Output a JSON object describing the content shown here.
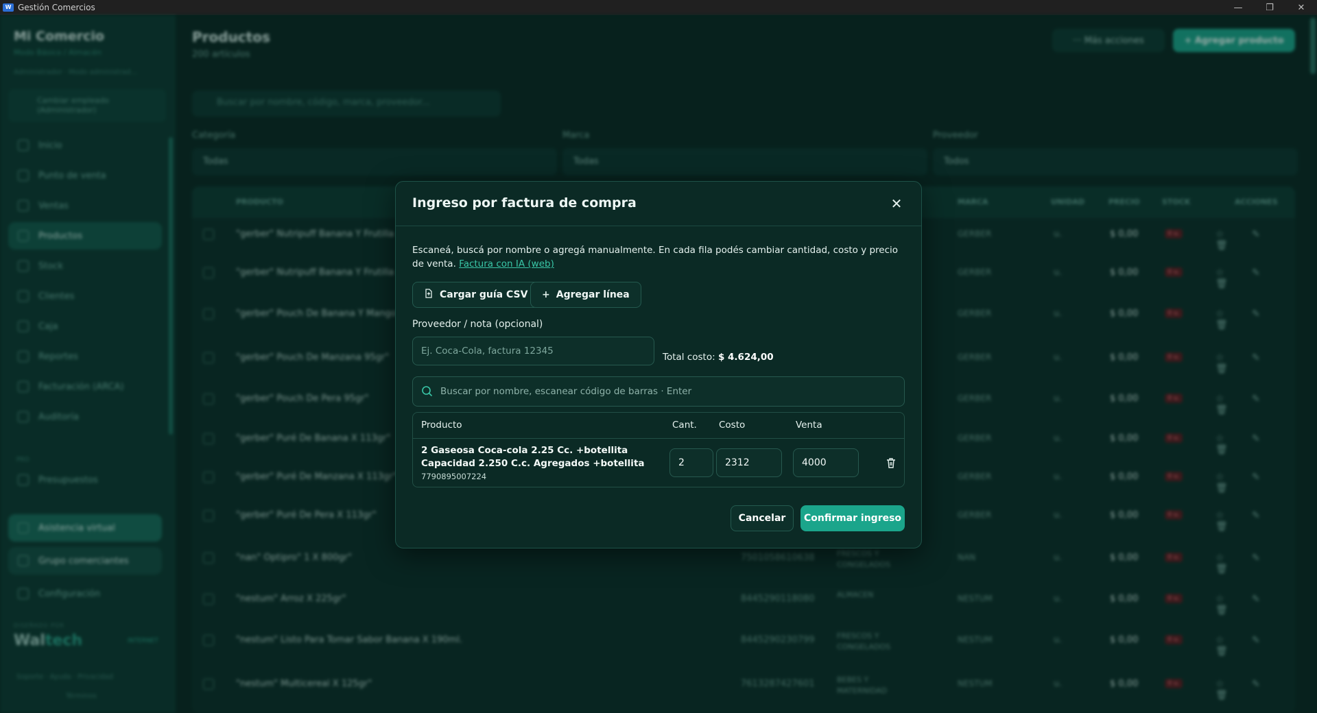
{
  "window": {
    "title": "Gestión Comercios",
    "logo_text": "W"
  },
  "sidebar": {
    "title": "Mi Comercio",
    "subtitle": "Modo Básico / Almacén",
    "admin": "Administrador · Modo administrad...",
    "switch_label": "Cambiar empleado (Administrador)",
    "items": [
      {
        "label": "Inicio",
        "icon": "home-icon"
      },
      {
        "label": "Punto de venta",
        "icon": "cart-icon"
      },
      {
        "label": "Ventas",
        "icon": "receipt-icon"
      },
      {
        "label": "Productos",
        "icon": "box-icon"
      },
      {
        "label": "Stock",
        "icon": "stock-icon"
      },
      {
        "label": "Clientes",
        "icon": "user-icon"
      },
      {
        "label": "Caja",
        "icon": "wallet-icon"
      },
      {
        "label": "Reportes",
        "icon": "chart-icon"
      },
      {
        "label": "Facturación (ARCA)",
        "icon": "invoice-icon"
      },
      {
        "label": "Auditoría",
        "icon": "audit-icon"
      },
      {
        "label": "Presupuestos",
        "icon": "document-icon"
      },
      {
        "label": "Asistencia virtual",
        "icon": "chat-icon"
      },
      {
        "label": "Grupo comerciantes",
        "icon": "group-icon"
      },
      {
        "label": "Configuración",
        "icon": "gear-icon"
      }
    ],
    "pro_label": "PRO",
    "brand_caption": "DISEÑADO POR",
    "brand_a": "Wal",
    "brand_b": "tech",
    "brand_tag": "INTERNET",
    "footer_links": "Soporte · Ayuda · Privacidad",
    "footer_terms": "Términos"
  },
  "main": {
    "title": "Productos",
    "count": "200 artículos",
    "more_actions": "··· Más acciones",
    "add_product": "+ Agregar producto",
    "search_placeholder": "Buscar por nombre, código, marca, proveedor...",
    "filters": [
      {
        "label": "Categoría",
        "value": "Todas"
      },
      {
        "label": "Marca",
        "value": "Todas"
      },
      {
        "label": "Proveedor",
        "value": "Todos"
      }
    ],
    "table_headers": [
      "PRODUCTO",
      "MARCA",
      "UNIDAD",
      "PRECIO",
      "STOCK",
      "ACCIONES"
    ],
    "rows": [
      {
        "name": "\"gerber\" Nutripuff Banana Y Frutilla",
        "code": "",
        "category": "",
        "brand": "GERBER",
        "unit": "u.",
        "price": "$ 0,00",
        "stock": "0 u."
      },
      {
        "name": "\"gerber\" Nutripuff Banana Y Frutilla",
        "code": "",
        "category": "",
        "brand": "GERBER",
        "unit": "u.",
        "price": "$ 0,00",
        "stock": "0 u."
      },
      {
        "name": "\"gerber\" Pouch De Banana Y Mango",
        "code": "",
        "category": "",
        "brand": "GERBER",
        "unit": "u.",
        "price": "$ 0,00",
        "stock": "0 u."
      },
      {
        "name": "\"gerber\" Pouch De Manzana 95gr\"",
        "code": "",
        "category": "",
        "brand": "GERBER",
        "unit": "u.",
        "price": "$ 0,00",
        "stock": "0 u."
      },
      {
        "name": "\"gerber\" Pouch De Pera 95gr\"",
        "code": "",
        "category": "",
        "brand": "GERBER",
        "unit": "u.",
        "price": "$ 0,00",
        "stock": "0 u."
      },
      {
        "name": "\"gerber\" Puré De Banana X 113gr\"",
        "code": "",
        "category": "",
        "brand": "GERBER",
        "unit": "u.",
        "price": "$ 0,00",
        "stock": "0 u."
      },
      {
        "name": "\"gerber\" Puré De Manzana X 113gr\"",
        "code": "",
        "category": "",
        "brand": "GERBER",
        "unit": "u.",
        "price": "$ 0,00",
        "stock": "0 u."
      },
      {
        "name": "\"gerber\" Puré De Pera X 113gr\"",
        "code": "",
        "category": "",
        "brand": "GERBER",
        "unit": "u.",
        "price": "$ 0,00",
        "stock": "0 u."
      },
      {
        "name": "\"nan\" Optipro\" 1 X 800gr\"",
        "code": "7501058610638",
        "category": "FRESCOS Y CONGELADOS",
        "brand": "NAN",
        "unit": "u.",
        "price": "$ 0,00",
        "stock": "0 u."
      },
      {
        "name": "\"nestum\" Arroz X 225gr\"",
        "code": "8445290118080",
        "category": "ALMACEN",
        "brand": "NESTUM",
        "unit": "u.",
        "price": "$ 0,00",
        "stock": "0 u."
      },
      {
        "name": "\"nestum\" Listo Para Tomar Sabor Banana X 190ml.",
        "code": "8445290230799",
        "category": "FRESCOS Y CONGELADOS",
        "brand": "NESTUM",
        "unit": "u.",
        "price": "$ 0,00",
        "stock": "0 u."
      },
      {
        "name": "\"nestum\" Multicereal X 125gr\"",
        "code": "7613287427601",
        "category": "BEBES Y MATERNIDAD",
        "brand": "NESTUM",
        "unit": "u.",
        "price": "$ 0,00",
        "stock": "0 u."
      }
    ],
    "row_actions": "☆ ✎ 🗑"
  },
  "modal": {
    "title": "Ingreso por factura de compra",
    "close_icon": "close-icon",
    "description": "Escaneá, buscá por nombre o agregá manualmente. En cada fila podés cambiar cantidad, costo y precio de venta.",
    "ai_link": "Factura con IA (web)",
    "csv_button": "Cargar guía CSV",
    "add_line_button": "Agregar línea",
    "supplier_label": "Proveedor / nota (opcional)",
    "supplier_placeholder": "Ej. Coca-Cola, factura 12345",
    "total_label": "Total costo:",
    "total_value": "$ 4.624,00",
    "search_placeholder": "Buscar por nombre, escanear código de barras · Enter",
    "columns": {
      "product": "Producto",
      "qty": "Cant.",
      "cost": "Costo",
      "sale": "Venta"
    },
    "lines": [
      {
        "product": "2 Gaseosa Coca-cola 2.25 Cc. +botellita Capacidad 2.250 C.c. Agregados +botellita",
        "barcode": "7790895007224",
        "qty": "2",
        "cost": "2312",
        "sale": "4000"
      }
    ],
    "cancel_button": "Cancelar",
    "confirm_button": "Confirmar ingreso"
  },
  "colors": {
    "accent": "#1ba58b",
    "background": "#0b2723",
    "modal": "#0b2a25",
    "link": "#39c6a7"
  }
}
